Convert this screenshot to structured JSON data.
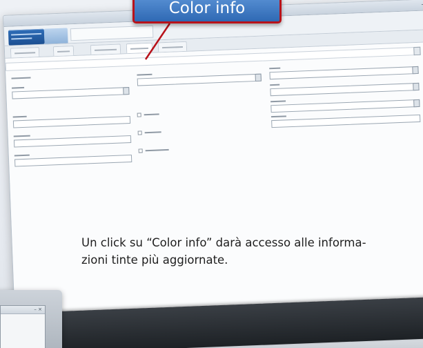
{
  "callout": {
    "label": "Color info"
  },
  "caption": {
    "text": "Un click su “Color info” darà accesso alle informa-\nzioni tinte più aggiornate."
  },
  "window": {
    "controls": "– ×"
  },
  "device": {
    "controls": "– ×"
  },
  "colors": {
    "callout_bg": "#3f7cc6",
    "callout_border": "#b8121a",
    "brand": "#1c4f91"
  }
}
